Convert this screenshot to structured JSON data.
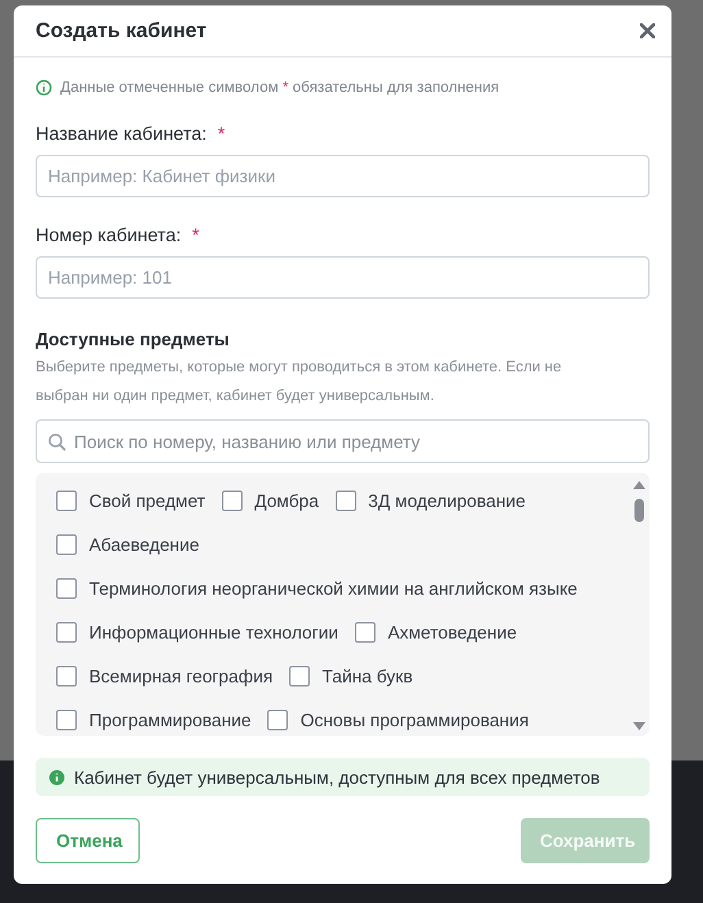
{
  "dialog": {
    "title": "Создать кабинет",
    "required_note": {
      "before": "Данные отмеченные символом",
      "mark": "*",
      "after": "обязательны для заполнения"
    },
    "fields": [
      {
        "label": "Название кабинета:",
        "required_mark": "*",
        "placeholder": "Например: Кабинет физики"
      },
      {
        "label": "Номер кабинета:",
        "required_mark": "*",
        "placeholder": "Например: 101"
      }
    ],
    "subjects": {
      "heading": "Доступные предметы",
      "hint": "Выберите предметы, которые могут проводиться в этом кабинете. Если не выбран ни один предмет, кабинет будет универсальным.",
      "search": {
        "placeholder": "Поиск по номеру, названию или предмету"
      },
      "rows": [
        [
          {
            "label": "Свой предмет",
            "checked": false
          },
          {
            "label": "Домбра",
            "checked": false
          },
          {
            "label": "3Д моделирование",
            "checked": false
          }
        ],
        [
          {
            "label": "Абаеведение",
            "checked": false
          }
        ],
        [
          {
            "label": "Терминология неорганической химии на английском языке",
            "checked": false
          }
        ],
        [
          {
            "label": "Информационные технологии",
            "checked": false
          },
          {
            "label": "Ахметоведение",
            "checked": false
          }
        ],
        [
          {
            "label": "Всемирная география",
            "checked": false
          },
          {
            "label": "Тайна букв",
            "checked": false
          }
        ],
        [
          {
            "label": "Программирование",
            "checked": false
          },
          {
            "label": "Основы программирования",
            "checked": false
          }
        ]
      ]
    },
    "notice": "Кабинет будет универсальным, доступным для всех предметов",
    "buttons": [
      {
        "label": "Отмена",
        "kind": "secondary",
        "disabled": false
      },
      {
        "label": "Сохранить",
        "kind": "primary",
        "disabled": true
      }
    ]
  }
}
